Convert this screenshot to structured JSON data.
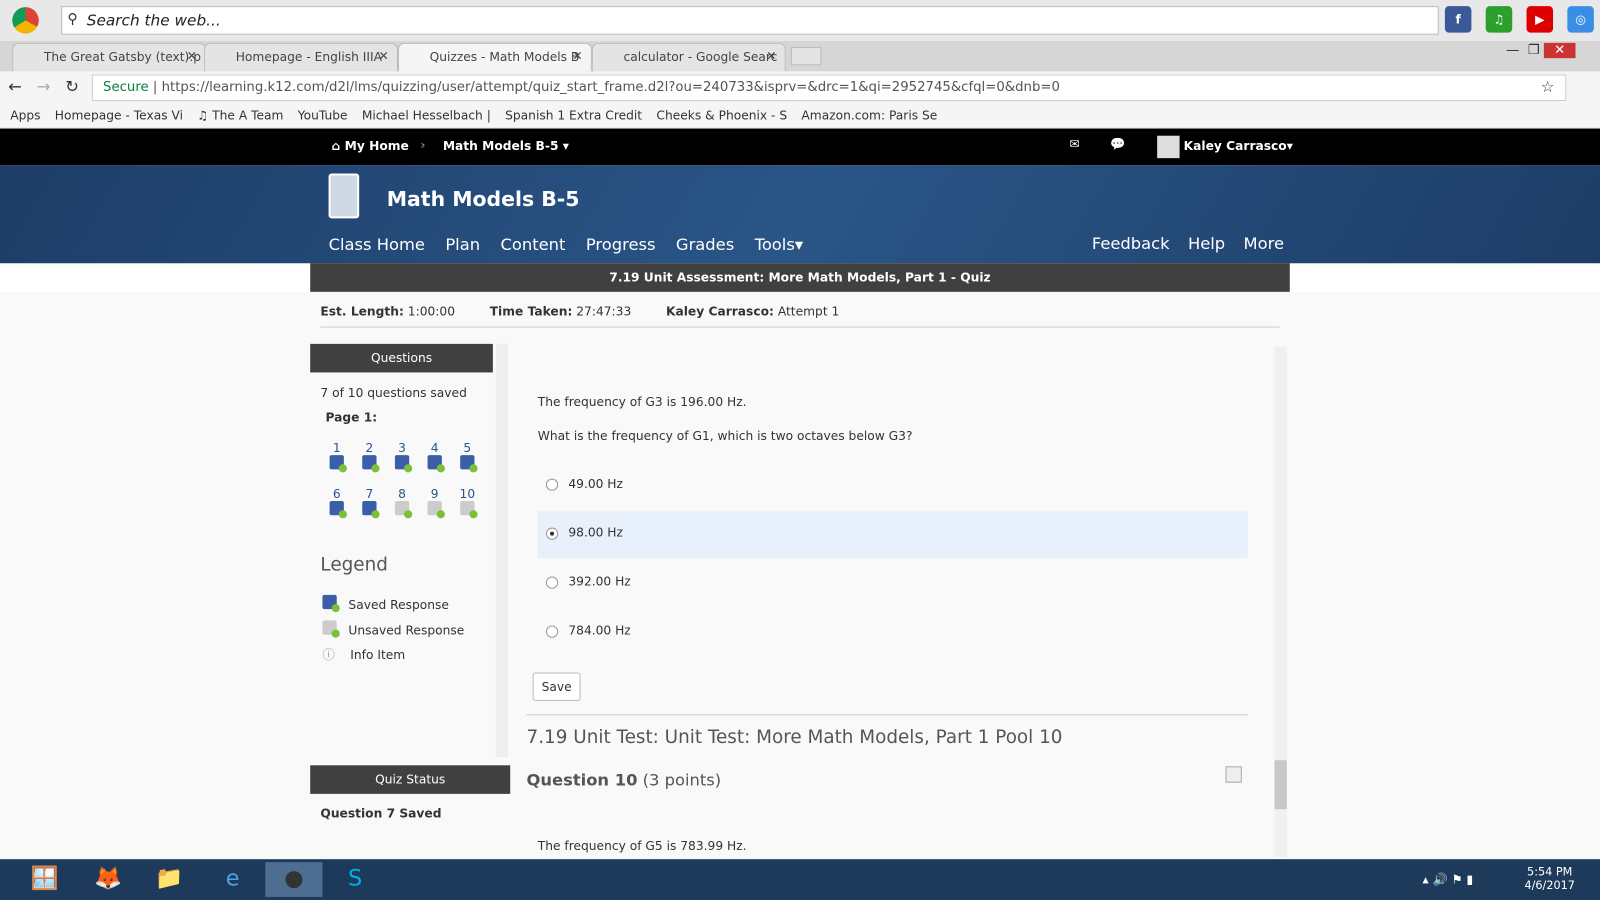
{
  "browser": {
    "search_placeholder": "Search the web...",
    "tabs": [
      {
        "label": "The Great Gatsby (text).p"
      },
      {
        "label": "Homepage - English IIIA"
      },
      {
        "label": "Quizzes - Math Models B"
      },
      {
        "label": "calculator - Google Searc"
      }
    ],
    "secure": "Secure",
    "url": "https://learning.k12.com/d2l/lms/quizzing/user/attempt/quiz_start_frame.d2l?ou=240733&isprv=&drc=1&qi=2952745&cfql=0&dnb=0",
    "bookmarks": [
      "Apps",
      "Homepage - Texas Vi",
      "♫ The A Team",
      "YouTube",
      "Michael Hesselbach |",
      "Spanish 1 Extra Credit",
      "Cheeks & Phoenix - S",
      "Amazon.com: Paris Se"
    ]
  },
  "topnav": {
    "home": "My Home",
    "course": "Math Models B-5",
    "user": "Kaley Carrasco"
  },
  "banner": {
    "title": "Math Models B-5",
    "menu": [
      "Class Home",
      "Plan",
      "Content",
      "Progress",
      "Grades",
      "Tools"
    ],
    "right": [
      "Feedback",
      "Help",
      "More"
    ]
  },
  "quiz": {
    "title": "7.19 Unit Assessment: More Math Models, Part 1 - Quiz",
    "est_label": "Est. Length:",
    "est": "1:00:00",
    "time_label": "Time Taken:",
    "time": "27:47:33",
    "attempt_user": "Kaley Carrasco:",
    "attempt": "Attempt 1"
  },
  "sidebar": {
    "header": "Questions",
    "saved": "7 of 10 questions saved",
    "page": "Page 1:",
    "questions": [
      {
        "n": "1",
        "saved": true
      },
      {
        "n": "2",
        "saved": true
      },
      {
        "n": "3",
        "saved": true
      },
      {
        "n": "4",
        "saved": true
      },
      {
        "n": "5",
        "saved": true
      },
      {
        "n": "6",
        "saved": true
      },
      {
        "n": "7",
        "saved": true
      },
      {
        "n": "8",
        "saved": false
      },
      {
        "n": "9",
        "saved": false
      },
      {
        "n": "10",
        "saved": false
      }
    ],
    "legend_title": "Legend",
    "legend": [
      "Saved Response",
      "Unsaved Response",
      "Info Item"
    ],
    "status_header": "Quiz Status",
    "status": "Question 7 Saved"
  },
  "question": {
    "stem1": "The frequency of G3 is 196.00 Hz.",
    "stem2": "What is the frequency of G1, which is two octaves below G3?",
    "options": [
      "49.00 Hz",
      "98.00 Hz",
      "392.00 Hz",
      "784.00 Hz"
    ],
    "selected": 1,
    "save": "Save"
  },
  "next": {
    "section": "7.19 Unit Test: Unit Test: More Math Models, Part 1 Pool 10",
    "label": "Question 10",
    "points": "(3 points)",
    "stem": "The frequency of G5 is 783.99 Hz."
  },
  "clock": {
    "time": "5:54 PM",
    "date": "4/6/2017"
  }
}
